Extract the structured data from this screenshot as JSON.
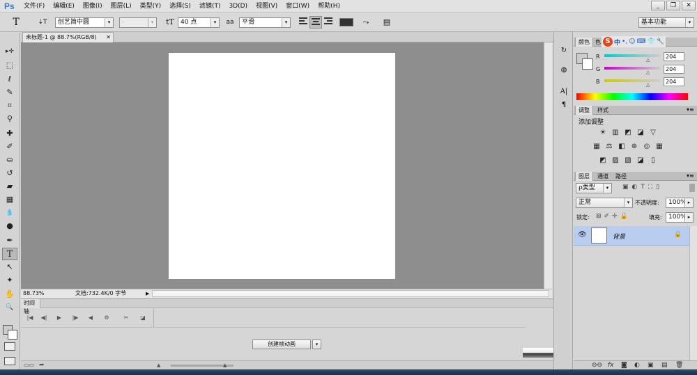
{
  "app": {
    "logo": "Ps"
  },
  "menu": [
    "文件(F)",
    "编辑(E)",
    "图像(I)",
    "图层(L)",
    "类型(Y)",
    "选择(S)",
    "滤镜(T)",
    "3D(D)",
    "视图(V)",
    "窗口(W)",
    "帮助(H)"
  ],
  "window_controls": {
    "minimize": "_",
    "restore": "❐",
    "close": "✕"
  },
  "options": {
    "tool_glyph": "T",
    "orient_glyph": "⇣T",
    "font_family": "创艺简中圆",
    "font_style": "-",
    "size_glyph": "tT",
    "font_size": "40 点",
    "aa_glyph": "aa",
    "anti_alias": "平滑",
    "warp_glyph": "⤳",
    "panel_glyph": "▤",
    "workspace": "基本功能"
  },
  "tools": [
    {
      "name": "move",
      "glyph": "▸✛"
    },
    {
      "name": "marquee",
      "glyph": "⬚"
    },
    {
      "name": "lasso",
      "glyph": "ℓ"
    },
    {
      "name": "quick-select",
      "glyph": "✎"
    },
    {
      "name": "crop",
      "glyph": "⌗"
    },
    {
      "name": "eyedropper",
      "glyph": "⚲"
    },
    {
      "name": "healing",
      "glyph": "✚"
    },
    {
      "name": "brush",
      "glyph": "✐"
    },
    {
      "name": "stamp",
      "glyph": "⛀"
    },
    {
      "name": "history-brush",
      "glyph": "↺"
    },
    {
      "name": "eraser",
      "glyph": "▰"
    },
    {
      "name": "gradient",
      "glyph": "▦"
    },
    {
      "name": "blur",
      "glyph": "💧"
    },
    {
      "name": "dodge",
      "glyph": "●"
    },
    {
      "name": "pen",
      "glyph": "✒"
    },
    {
      "name": "type",
      "glyph": "T"
    },
    {
      "name": "path-select",
      "glyph": "↖"
    },
    {
      "name": "shape",
      "glyph": "✦"
    },
    {
      "name": "hand",
      "glyph": "✋"
    },
    {
      "name": "zoom",
      "glyph": "🔍"
    }
  ],
  "document": {
    "tab_title": "未标题-1 @ 88.7%(RGB/8)",
    "zoom": "88.73%",
    "doc_info": "文档:732.4K/0 字节"
  },
  "timeline": {
    "title": "时间轴",
    "create_button": "创建帧动画"
  },
  "color_panel": {
    "tabs": [
      "颜色",
      "色"
    ],
    "channels": [
      {
        "label": "R",
        "value": "204",
        "color": "#ff4444"
      },
      {
        "label": "G",
        "value": "204",
        "color": "#cc44cc"
      },
      {
        "label": "B",
        "value": "204",
        "color": "#dddd44"
      }
    ],
    "foreground": "#cccccc",
    "background": "#ffffff"
  },
  "ime": {
    "logo": "S",
    "lang": "中",
    "items": [
      "•,",
      "☺",
      "⌨",
      "👕",
      "🔧"
    ]
  },
  "adjust_panel": {
    "tabs": [
      "调整",
      "样式"
    ],
    "title": "添加调整",
    "rows": [
      [
        "☀",
        "▥",
        "◩",
        "◪",
        "▽"
      ],
      [
        "▦",
        "⚖",
        "◧",
        "⊚",
        "◎",
        "▦"
      ],
      [
        "◩",
        "▨",
        "▧",
        "◪",
        "▯"
      ]
    ]
  },
  "layers_panel": {
    "tabs": [
      "图层",
      "通道",
      "路径"
    ],
    "filter_kind": "ρ类型",
    "blend_mode": "正常",
    "opacity_label": "不透明度:",
    "opacity": "100%",
    "lock_label": "锁定:",
    "fill_label": "填充:",
    "fill": "100%",
    "layer_name": "背景",
    "footer_icons": [
      "⊖⊖",
      "fx",
      "◙",
      "◐",
      "▣",
      "▤",
      "🗑"
    ]
  }
}
